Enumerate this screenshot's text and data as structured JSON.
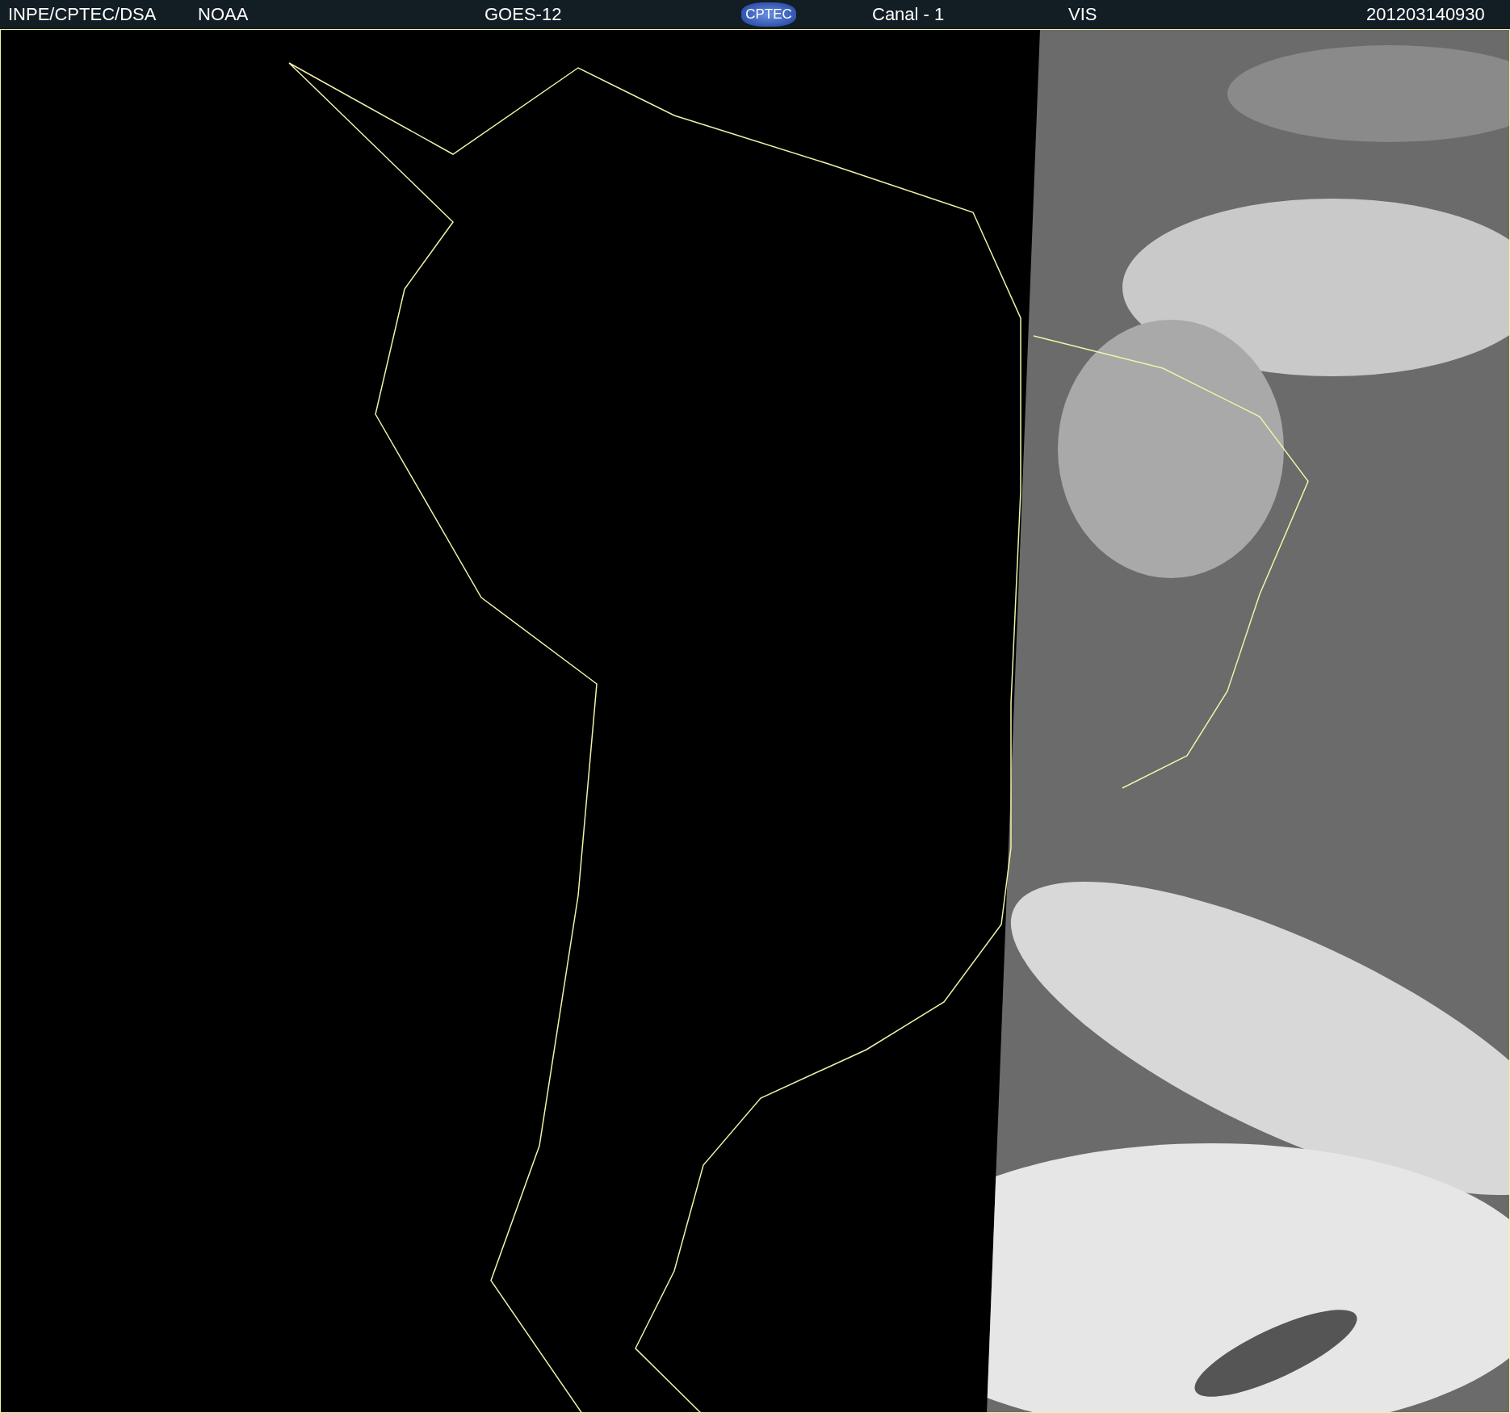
{
  "header": {
    "items": [
      {
        "kind": "text",
        "text": "INPE/CPTEC/DSA"
      },
      {
        "kind": "text",
        "text": "NOAA"
      },
      {
        "kind": "text",
        "text": "GOES-12"
      },
      {
        "kind": "logo",
        "text": "CPTEC"
      },
      {
        "kind": "text",
        "text": "Canal - 1"
      },
      {
        "kind": "text",
        "text": "VIS"
      },
      {
        "kind": "text",
        "text": "201203140930"
      }
    ]
  }
}
